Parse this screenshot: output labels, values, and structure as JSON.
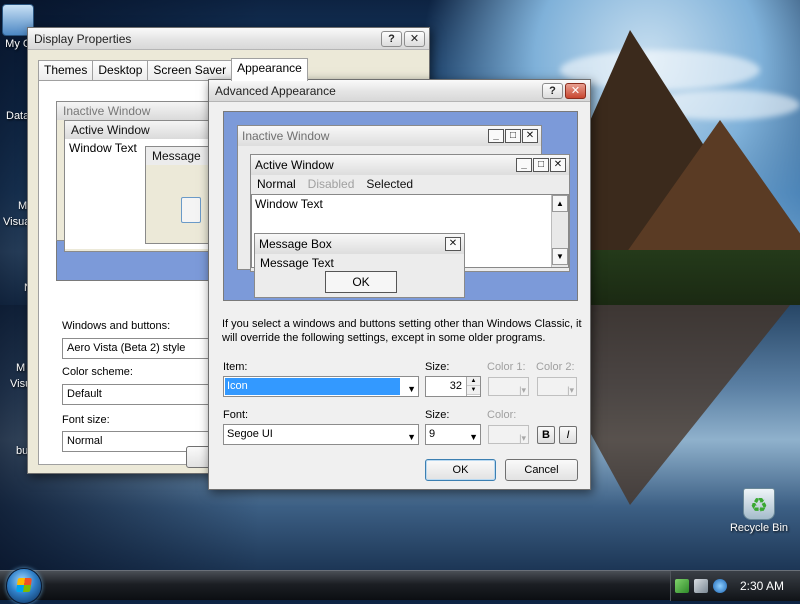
{
  "desktop": {
    "icons": {
      "computer": "My C",
      "recycle_bin": "Recycle Bin"
    },
    "left_fragments": [
      "Data",
      "Mi",
      "Visua",
      "N",
      "M",
      "Visu",
      "bu"
    ]
  },
  "display_properties": {
    "title": "Display Properties",
    "help": "?",
    "close": "✕",
    "tabs": [
      "Themes",
      "Desktop",
      "Screen Saver",
      "Appearance"
    ],
    "preview": {
      "inactive": "Inactive Window",
      "active": "Active Window",
      "window_text": "Window Text",
      "message": "Message"
    },
    "windows_buttons_label": "Windows and buttons:",
    "windows_buttons_value": "Aero Vista (Beta 2) style",
    "color_scheme_label": "Color scheme:",
    "color_scheme_value": "Default",
    "font_size_label": "Font size:",
    "font_size_value": "Normal"
  },
  "advanced": {
    "title": "Advanced Appearance",
    "help": "?",
    "close": "✕",
    "preview": {
      "inactive": "Inactive Window",
      "active": "Active Window",
      "menu_normal": "Normal",
      "menu_disabled": "Disabled",
      "menu_selected": "Selected",
      "window_text": "Window Text",
      "message_box": "Message Box",
      "message_text": "Message Text",
      "ok": "OK"
    },
    "note": "If you select a windows and buttons setting other than Windows Classic, it will override the following settings, except in some older programs.",
    "item_label": "Item:",
    "item_value": "Icon",
    "size_label": "Size:",
    "item_size": "32",
    "color1_label": "Color 1:",
    "color2_label": "Color 2:",
    "font_label": "Font:",
    "font_value": "Segoe UI",
    "font_size_label": "Size:",
    "font_size": "9",
    "color_label": "Color:",
    "bold": "B",
    "italic": "I",
    "ok": "OK",
    "cancel": "Cancel"
  },
  "taskbar": {
    "time": "2:30 AM"
  }
}
